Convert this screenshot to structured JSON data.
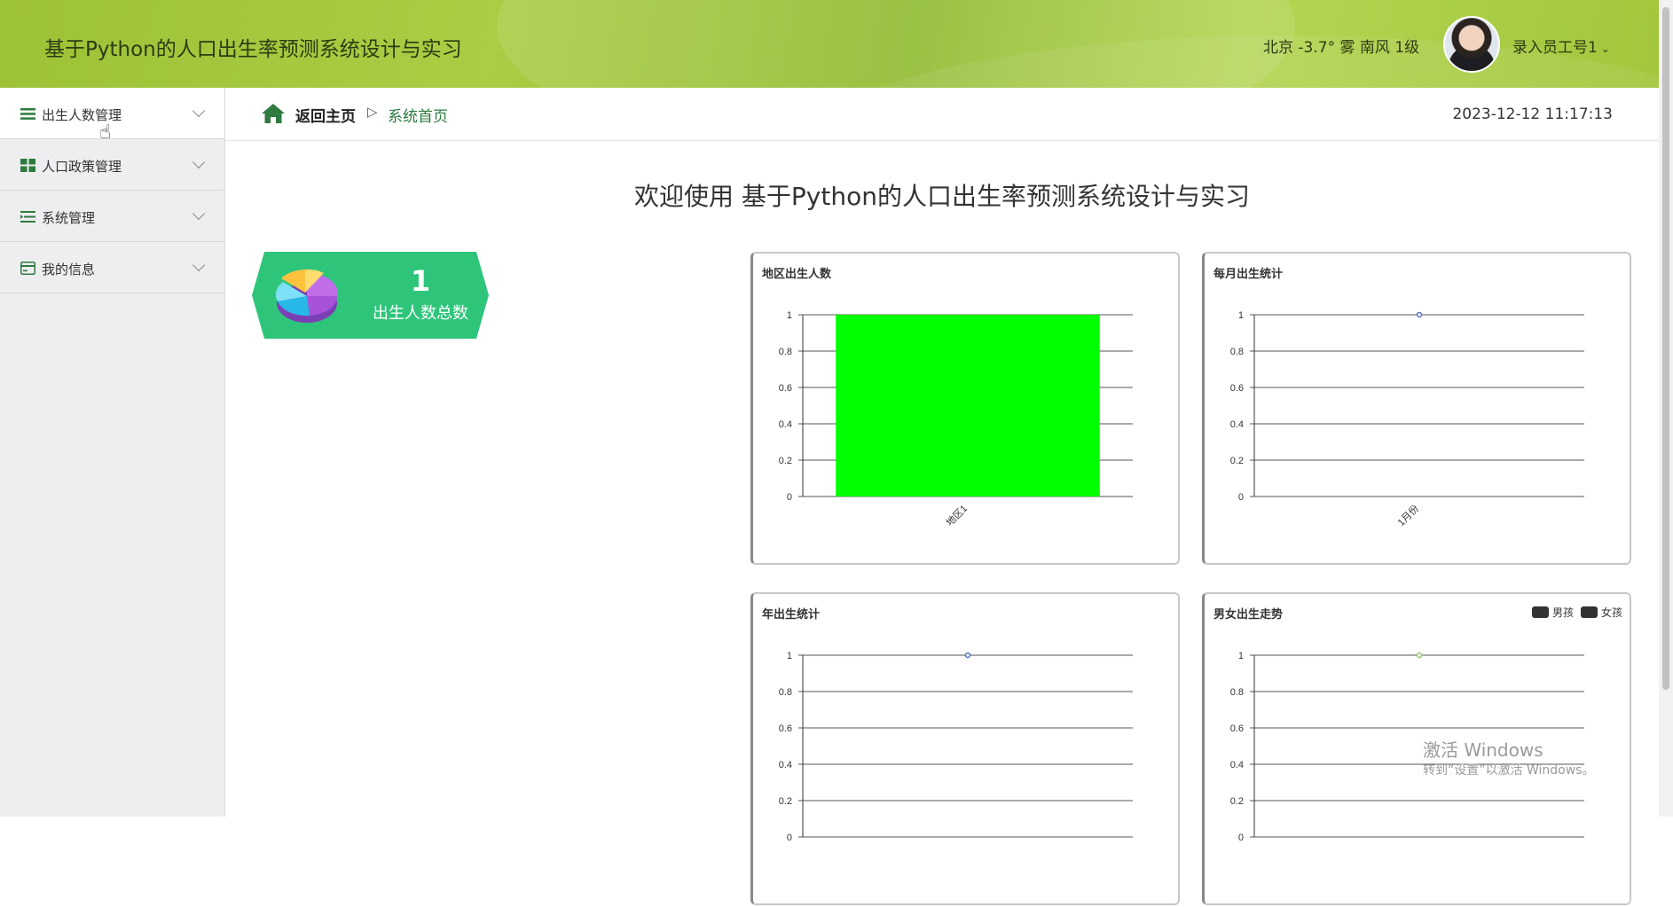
{
  "header": {
    "title": "基于Python的人口出生率预测系统设计与实习",
    "weather": "北京  -3.7°  雾  南风  1级",
    "user": "录入员工号1"
  },
  "sidebar": {
    "items": [
      {
        "label": "出生人数管理",
        "icon": "list-icon"
      },
      {
        "label": "人口政策管理",
        "icon": "grid-icon"
      },
      {
        "label": "系统管理",
        "icon": "menu-icon"
      },
      {
        "label": "我的信息",
        "icon": "card-icon"
      }
    ]
  },
  "breadcrumb": {
    "home": "返回主页",
    "separator": "▷",
    "current": "系统首页"
  },
  "clock": "2023-12-12 11:17:13",
  "welcome": "欢迎使用 基于Python的人口出生率预测系统设计与实习",
  "stat": {
    "value": "1",
    "label": "出生人数总数"
  },
  "panels": {
    "region": {
      "title": "地区出生人数"
    },
    "monthly": {
      "title": "每月出生统计"
    },
    "yearly": {
      "title": "年出生统计"
    },
    "gender": {
      "title": "男女出生走势",
      "legend": [
        "男孩",
        "女孩"
      ]
    }
  },
  "chart_data": [
    {
      "type": "bar",
      "title": "地区出生人数",
      "categories": [
        "地区1"
      ],
      "values": [
        1
      ],
      "ylim": [
        0,
        1
      ],
      "yticks": [
        "0",
        "0.2",
        "0.4",
        "0.6",
        "0.8",
        "1"
      ],
      "color": "#00ff00"
    },
    {
      "type": "line",
      "title": "每月出生统计",
      "categories": [
        "1月份"
      ],
      "values": [
        1
      ],
      "ylim": [
        0,
        1
      ],
      "yticks": [
        "0",
        "0.2",
        "0.4",
        "0.6",
        "0.8",
        "1"
      ],
      "color": "#5470c6"
    },
    {
      "type": "line",
      "title": "年出生统计",
      "categories": [
        ""
      ],
      "values": [
        1
      ],
      "ylim": [
        0,
        1
      ],
      "yticks": [
        "0",
        "0.2",
        "0.4",
        "0.6",
        "0.8",
        "1"
      ],
      "color": "#5470c6"
    },
    {
      "type": "line",
      "title": "男女出生走势",
      "categories": [
        ""
      ],
      "series": [
        {
          "name": "男孩",
          "values": [
            1
          ]
        },
        {
          "name": "女孩",
          "values": [
            1
          ]
        }
      ],
      "ylim": [
        0,
        1
      ],
      "yticks": [
        "0",
        "0.2",
        "0.4",
        "0.6",
        "0.8",
        "1"
      ],
      "color": "#91cc75"
    }
  ],
  "watermark": {
    "line1": "激活 Windows",
    "line2": "转到“设置”以激活 Windows。"
  }
}
